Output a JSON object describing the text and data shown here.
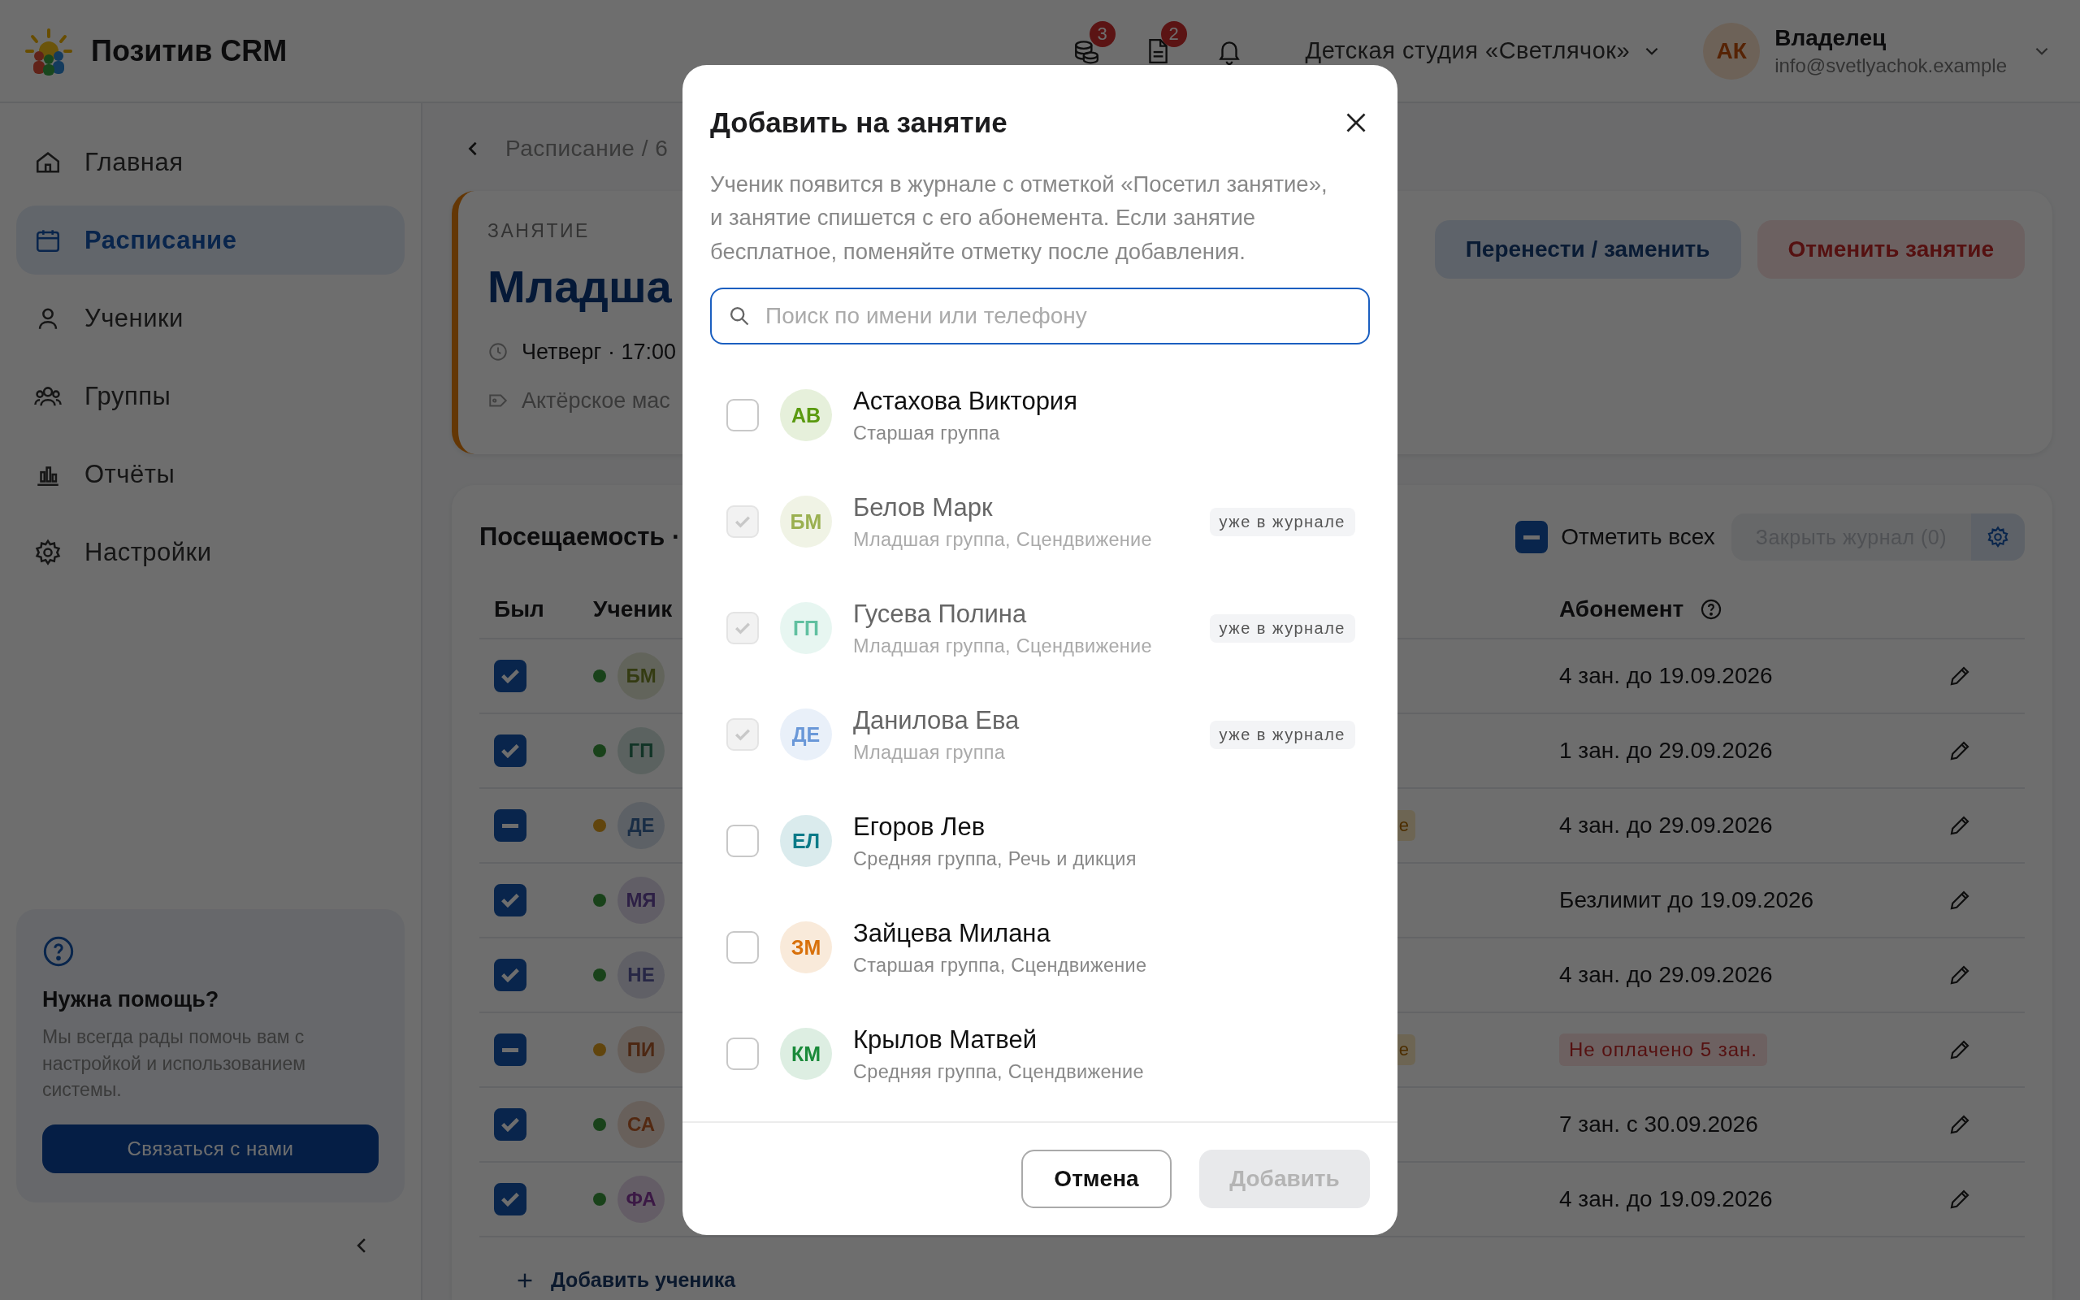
{
  "header": {
    "app_name": "Позитив CRM",
    "icons": [
      {
        "kind": "coins",
        "badge": "3"
      },
      {
        "kind": "document",
        "badge": "2"
      },
      {
        "kind": "bell"
      }
    ],
    "studio": "Детская студия «Светлячок»",
    "user": {
      "initials": "АК",
      "role": "Владелец",
      "email": "info@svetlyachok.example"
    }
  },
  "sidebar": {
    "items": [
      {
        "label": "Главная",
        "kind": "home",
        "selected": false
      },
      {
        "label": "Расписание",
        "kind": "calendar",
        "selected": true
      },
      {
        "label": "Ученики",
        "kind": "user",
        "selected": false
      },
      {
        "label": "Группы",
        "kind": "users",
        "selected": false
      },
      {
        "label": "Отчёты",
        "kind": "chart",
        "selected": false
      },
      {
        "label": "Настройки",
        "kind": "gear",
        "selected": false
      }
    ],
    "help": {
      "title": "Нужна помощь?",
      "text": "Мы всегда рады помочь вам с настройкой и использованием системы.",
      "button": "Связаться с нами"
    }
  },
  "breadcrumb": "Расписание / 6",
  "lesson": {
    "label": "ЗАНЯТИЕ",
    "title": "Младша",
    "time": "Четверг · 17:00",
    "tag": "Актёрское мас",
    "actions": [
      {
        "label": "Перенести / заменить",
        "kind": "secondary"
      },
      {
        "label": "Отменить занятие",
        "kind": "danger"
      }
    ]
  },
  "attendance": {
    "title": "Посещаемость ·",
    "mark_all": {
      "label": "Отметить всех",
      "checked": true,
      "indeterminate": true
    },
    "close_button": "Закрыть журнал (0)",
    "columns": [
      "Был",
      "Ученик",
      "Абонемент"
    ],
    "rows": [
      {
        "checked": true,
        "indeterminate": false,
        "warning": false,
        "initials": "БМ",
        "subscription": "4 зан. до 19.09.2026",
        "unpaid": false
      },
      {
        "checked": true,
        "indeterminate": false,
        "warning": false,
        "initials": "ГП",
        "subscription": "1 зан. до 29.09.2026",
        "unpaid": false
      },
      {
        "checked": true,
        "indeterminate": true,
        "warning": true,
        "initials": "ДЕ",
        "tag": "е",
        "subscription": "4 зан. до 29.09.2026",
        "unpaid": false
      },
      {
        "checked": true,
        "indeterminate": false,
        "warning": false,
        "initials": "МЯ",
        "subscription": "Безлимит до 19.09.2026",
        "unpaid": false
      },
      {
        "checked": true,
        "indeterminate": false,
        "warning": false,
        "initials": "НЕ",
        "subscription": "4 зан. до 29.09.2026",
        "unpaid": false
      },
      {
        "checked": true,
        "indeterminate": true,
        "warning": true,
        "initials": "ПИ",
        "tag": "е",
        "subscription": "Не оплачено 5 зан.",
        "unpaid": true
      },
      {
        "checked": true,
        "indeterminate": false,
        "warning": false,
        "initials": "СА",
        "subscription": "7 зан. с 30.09.2026",
        "unpaid": false
      },
      {
        "checked": true,
        "indeterminate": false,
        "warning": false,
        "initials": "ФА",
        "subscription": "4 зан. до 19.09.2026",
        "unpaid": false
      }
    ],
    "add_student": "Добавить ученика"
  },
  "dialog": {
    "title": "Добавить на занятие",
    "description": "Ученик появится в журнале с отметкой «Посетил занятие», и занятие спишется с его абонемента. Если занятие бесплатное, поменяйте отметку после добавления.",
    "search": {
      "placeholder": "Поиск по имени или телефону"
    },
    "students": [
      {
        "initials": "АВ",
        "name": "Астахова Виктория",
        "group": "Старшая группа",
        "color": "#5a9a10",
        "checked": false,
        "disabled": false
      },
      {
        "initials": "БМ",
        "name": "Белов Марк",
        "group": "Младшая группа, Сцендвижение",
        "color": "#9ab050",
        "checked": true,
        "disabled": true,
        "tag": "уже в журнале"
      },
      {
        "initials": "ГП",
        "name": "Гусева Полина",
        "group": "Младшая группа, Сцендвижение",
        "color": "#60c0a0",
        "checked": true,
        "disabled": true,
        "tag": "уже в журнале"
      },
      {
        "initials": "ДЕ",
        "name": "Данилова Ева",
        "group": "Младшая группа",
        "color": "#6a98d8",
        "checked": true,
        "disabled": true,
        "tag": "уже в журнале"
      },
      {
        "initials": "ЕЛ",
        "name": "Егоров Лев",
        "group": "Средняя группа, Речь и дикция",
        "color": "#0a7a88",
        "checked": false,
        "disabled": false
      },
      {
        "initials": "ЗМ",
        "name": "Зайцева Милана",
        "group": "Старшая группа, Сцендвижение",
        "color": "#d8700a",
        "checked": false,
        "disabled": false
      },
      {
        "initials": "КМ",
        "name": "Крылов Матвей",
        "group": "Средняя группа, Сцендвижение",
        "color": "#1a8a3a",
        "checked": false,
        "disabled": false
      }
    ],
    "buttons": [
      {
        "label": "Отмена",
        "kind": "secondary",
        "disabled": false
      },
      {
        "label": "Добавить",
        "kind": "primary",
        "disabled": true
      }
    ]
  }
}
